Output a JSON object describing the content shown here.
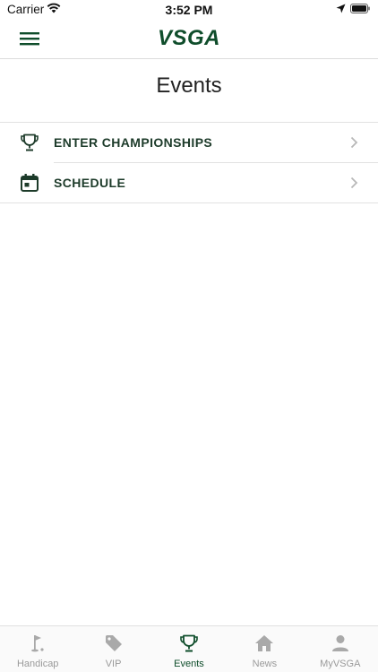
{
  "status_bar": {
    "carrier": "Carrier",
    "time": "3:52 PM"
  },
  "header": {
    "logo": "VSGA"
  },
  "page": {
    "title": "Events"
  },
  "list": {
    "items": [
      {
        "label": "ENTER CHAMPIONSHIPS",
        "icon": "trophy-icon"
      },
      {
        "label": "SCHEDULE",
        "icon": "calendar-icon"
      }
    ]
  },
  "tab_bar": {
    "tabs": [
      {
        "label": "Handicap",
        "icon": "golf-flag-icon",
        "active": false
      },
      {
        "label": "VIP",
        "icon": "tag-icon",
        "active": false
      },
      {
        "label": "Events",
        "icon": "trophy-icon",
        "active": true
      },
      {
        "label": "News",
        "icon": "home-icon",
        "active": false
      },
      {
        "label": "MyVSGA",
        "icon": "person-icon",
        "active": false
      }
    ]
  },
  "colors": {
    "brand_green": "#0f4d2b",
    "inactive_gray": "#9a9a9a"
  }
}
